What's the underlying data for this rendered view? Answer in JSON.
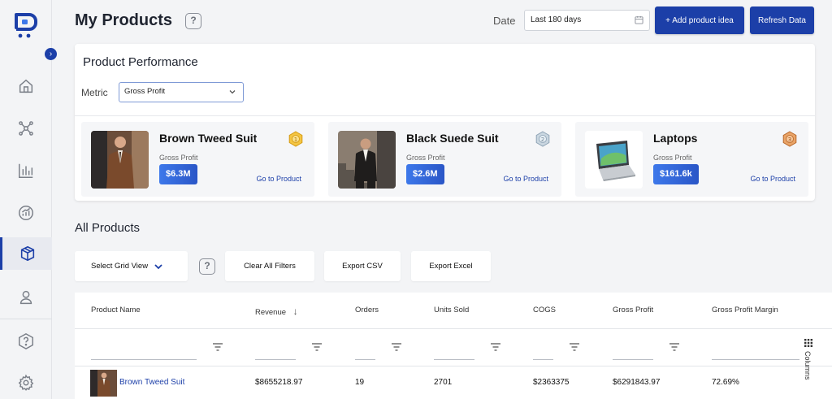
{
  "header": {
    "title": "My Products",
    "help_glyph": "?",
    "date_label": "Date",
    "date_value": "Last 180 days",
    "add_button": "+ Add product idea",
    "refresh_button": "Refresh Data"
  },
  "sidebar": {
    "collapse_glyph": "›",
    "items": [
      {
        "icon": "home-icon"
      },
      {
        "icon": "network-icon"
      },
      {
        "icon": "bar-chart-icon"
      },
      {
        "icon": "growth-chart-icon"
      },
      {
        "icon": "package-icon",
        "active": true
      },
      {
        "icon": "user-icon"
      },
      {
        "icon": "help-icon"
      },
      {
        "icon": "gear-icon"
      }
    ]
  },
  "performance": {
    "title": "Product Performance",
    "metric_label": "Metric",
    "metric_value": "Gross Profit",
    "top_products": [
      {
        "name": "Brown Tweed Suit",
        "metric": "Gross Profit",
        "value": "$6.3M",
        "link": "Go to Product",
        "rank": "1",
        "medal_color": "#e8b22a"
      },
      {
        "name": "Black Suede Suit",
        "metric": "Gross Profit",
        "value": "$2.6M",
        "link": "Go to Product",
        "rank": "2",
        "medal_color": "#9fb3c4"
      },
      {
        "name": "Laptops",
        "metric": "Gross Profit",
        "value": "$161.6k",
        "link": "Go to Product",
        "rank": "3",
        "medal_color": "#d98b4a"
      }
    ]
  },
  "all_products": {
    "title": "All Products",
    "select_grid_view": "Select Grid View",
    "clear_filters": "Clear All Filters",
    "export_csv": "Export CSV",
    "export_excel": "Export Excel",
    "columns": [
      "Product Name",
      "Revenue",
      "Orders",
      "Units Sold",
      "COGS",
      "Gross Profit",
      "Gross Profit Margin"
    ],
    "sort_glyph": "↓",
    "columns_panel_label": "Columns",
    "rows": [
      {
        "product_name": "Brown Tweed Suit",
        "revenue": "$8655218.97",
        "orders": "19",
        "units_sold": "2701",
        "cogs": "$2363375",
        "gross_profit": "$6291843.97",
        "gross_profit_margin": "72.69%"
      }
    ]
  },
  "colors": {
    "primary": "#1c3fa8",
    "value_badge": "#3d78ea"
  }
}
